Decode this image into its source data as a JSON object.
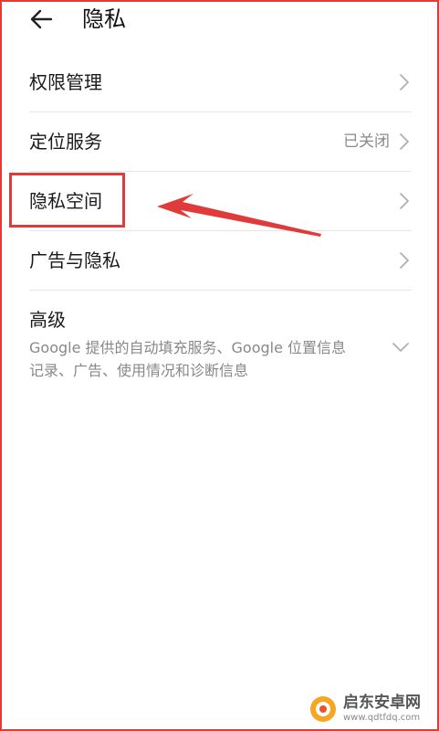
{
  "header": {
    "title": "隐私",
    "back_icon": "arrow-left-icon"
  },
  "settings": {
    "items": [
      {
        "label": "权限管理",
        "value": ""
      },
      {
        "label": "定位服务",
        "value": "已关闭"
      },
      {
        "label": "隐私空间",
        "value": ""
      },
      {
        "label": "广告与隐私",
        "value": ""
      }
    ],
    "advanced": {
      "title": "高级",
      "description": "Google 提供的自动填充服务、Google 位置信息记录、广告、使用情况和诊断信息"
    }
  },
  "annotation": {
    "color": "#e03a3a"
  },
  "watermark": {
    "name": "启东安卓网",
    "url": "www.qdtfdq.com"
  }
}
